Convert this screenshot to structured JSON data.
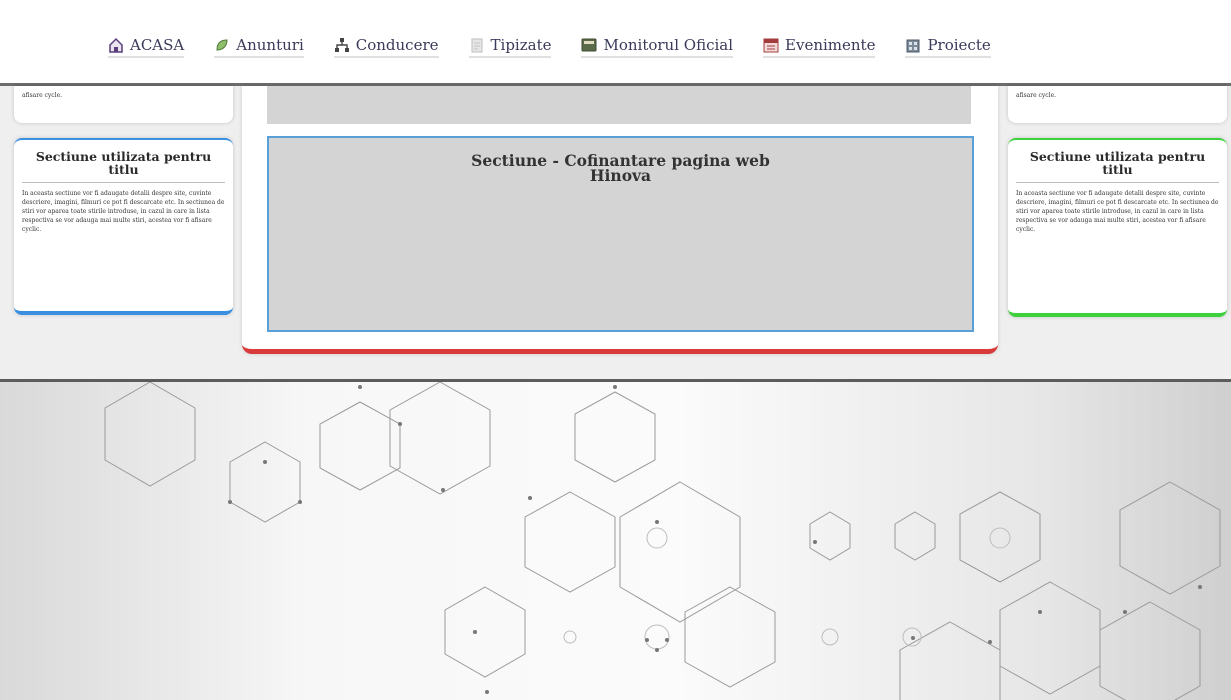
{
  "nav": {
    "items": [
      {
        "label": "ACASA",
        "icon": "home-icon"
      },
      {
        "label": "Anunturi",
        "icon": "leaf-icon"
      },
      {
        "label": "Conducere",
        "icon": "network-icon"
      },
      {
        "label": "Tipizate",
        "icon": "document-icon"
      },
      {
        "label": "Monitorul Oficial",
        "icon": "monitor-icon"
      },
      {
        "label": "Evenimente",
        "icon": "calendar-icon"
      },
      {
        "label": "Proiecte",
        "icon": "building-icon"
      }
    ]
  },
  "left_box_top": {
    "text": "afisare cycle."
  },
  "left_box": {
    "title": "Sectiune utilizata pentru titlu",
    "body": "In aceasta sectiune vor fi adaugate detalii despre site, cuvinte descriere, imagini, filmuri ce pot fi descarcate etc. In sectiunea de stiri vor aparea toate stirile introduse, in cazul in care in lista respectiva se vor adauga mai multe stiri, acestea vor fi afisare cyclic."
  },
  "right_box_top": {
    "text": "afisare cycle."
  },
  "right_box": {
    "title": "Sectiune utilizata pentru titlu",
    "body": "In aceasta sectiune vor fi adaugate detalii despre site, cuvinte descriere, imagini, filmuri ce pot fi descarcate etc. In sectiunea de stiri vor aparea toate stirile introduse, in cazul in care in lista respectiva se vor adauga mai multe stiri, acestea vor fi afisare cyclic."
  },
  "center": {
    "cofinantare_title_line1": "Sectiune - Cofinantare pagina web",
    "cofinantare_title_line2": "Hinova"
  },
  "colors": {
    "left_accent": "#3b8fe0",
    "right_accent": "#3ed13e",
    "center_accent": "#d93a3a",
    "cofin_border": "#5aa0d8"
  }
}
